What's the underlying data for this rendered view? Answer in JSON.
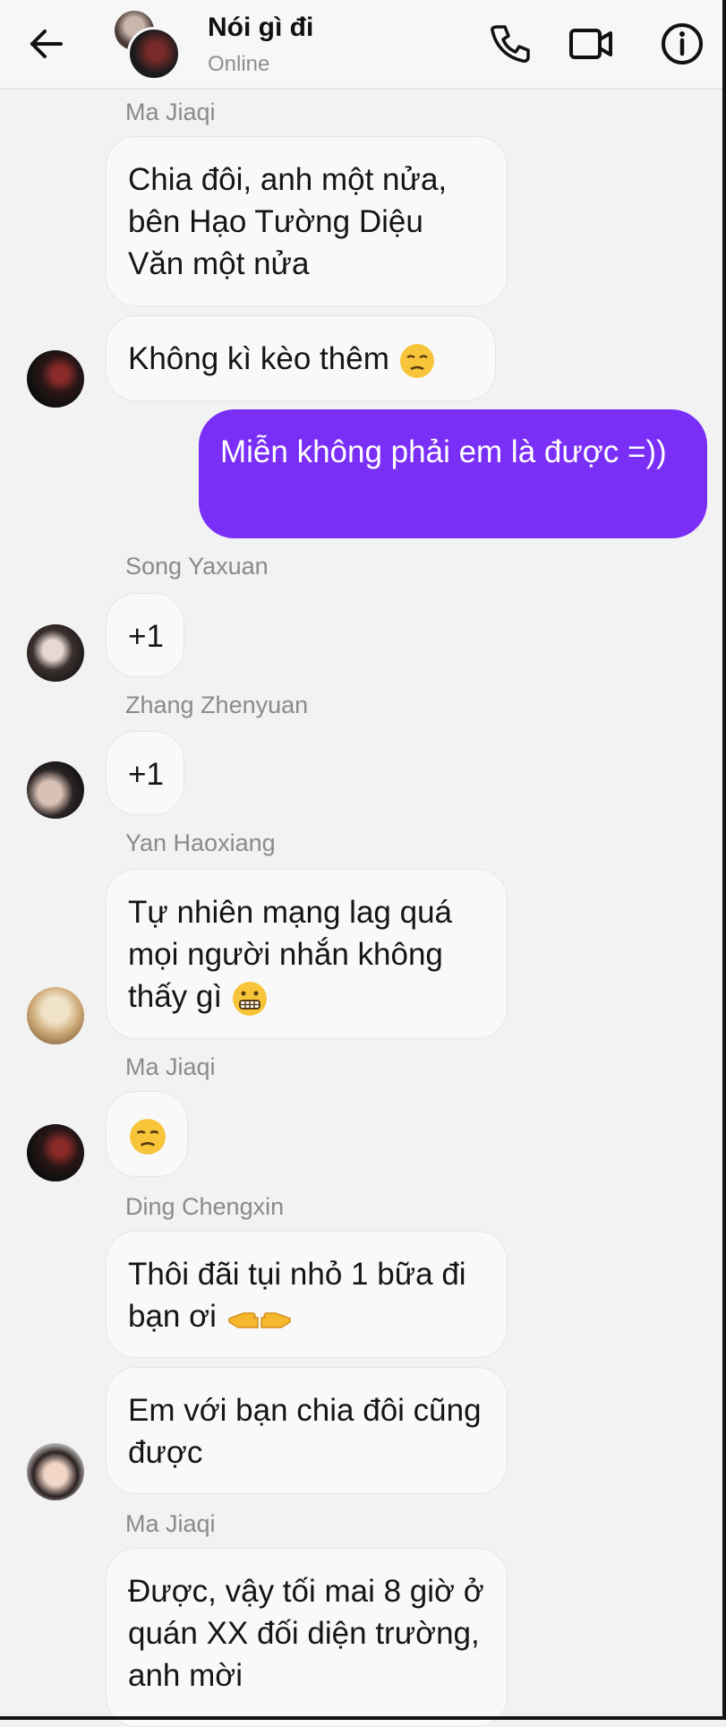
{
  "header": {
    "title": "Nói gì đi",
    "status": "Online"
  },
  "colors": {
    "accent": "#7a2ff7",
    "incoming_bubble": "#f9f9f9",
    "background": "#f2f2f2",
    "sender_name": "#8a8a8a"
  },
  "icons": {
    "back": "arrow-left-icon",
    "call": "phone-icon",
    "video": "video-camera-icon",
    "info": "info-icon"
  },
  "messages": [
    {
      "sender": "Ma Jiaqi",
      "text": "Chia đôi, anh một nửa, bên Hạo Tường Diệu Văn một nửa"
    },
    {
      "sender": "Ma Jiaqi",
      "text": "Không kì kèo thêm",
      "emoji": "unamused-face"
    },
    {
      "sender": "me",
      "text": "Miễn không phải em là được =))"
    },
    {
      "sender": "Song Yaxuan",
      "text": "+1"
    },
    {
      "sender": "Zhang Zhenyuan",
      "text": "+1"
    },
    {
      "sender": "Yan Haoxiang",
      "text": "Tự nhiên mạng lag quá mọi người nhắn không thấy gì",
      "emoji": "grimacing-face"
    },
    {
      "sender": "Ma Jiaqi",
      "text": "",
      "emoji": "unamused-face"
    },
    {
      "sender": "Ding Chengxin",
      "text": "Thôi đãi tụi nhỏ 1 bữa đi bạn ơi",
      "emoji": "pointing-hands"
    },
    {
      "sender": "Ding Chengxin",
      "text": "Em với bạn chia đôi cũng được"
    },
    {
      "sender": "Ma Jiaqi",
      "text": "Được, vậy tối mai 8 giờ ở quán XX đối diện trường, anh mời"
    }
  ]
}
